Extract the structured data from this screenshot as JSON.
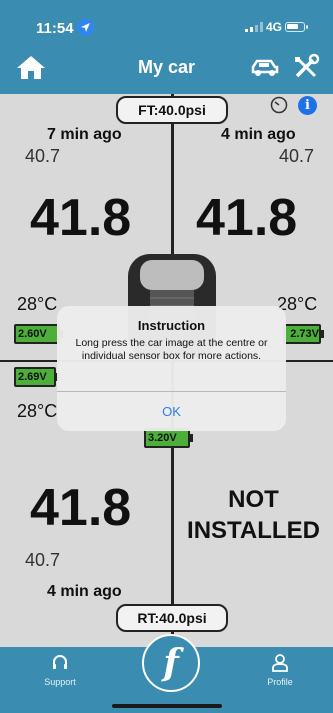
{
  "status": {
    "time": "11:54",
    "network": "4G",
    "battery_level": 0.7
  },
  "header": {
    "title": "My car"
  },
  "pressure": {
    "front": "FT:40.0psi",
    "rear": "RT:40.0psi"
  },
  "sensors": {
    "front_left": {
      "ago": "7 min ago",
      "prev": "40.7",
      "value": "41.8",
      "temp": "28°C",
      "battery": "2.60V"
    },
    "front_right": {
      "ago": "4 min ago",
      "prev": "40.7",
      "value": "41.8",
      "temp": "28°C",
      "battery": "2.73V"
    },
    "rear_left": {
      "ago": "4 min ago",
      "prev": "40.7",
      "value": "41.8",
      "temp": "28°C",
      "battery": "2.69V"
    },
    "rear_right": {
      "status": "NOT INSTALLED"
    },
    "center": {
      "battery": "3.20V"
    }
  },
  "dialog": {
    "title": "Instruction",
    "message": "Long press the car image at the centre or individual sensor box for more actions.",
    "ok_label": "OK"
  },
  "nav": {
    "support_label": "Support",
    "profile_label": "Profile",
    "logo_letter": "f"
  },
  "colors": {
    "primary": "#3a8db0",
    "background": "#d9d9d9",
    "battery_ok": "#4caf3a",
    "link": "#2f7ee0"
  }
}
